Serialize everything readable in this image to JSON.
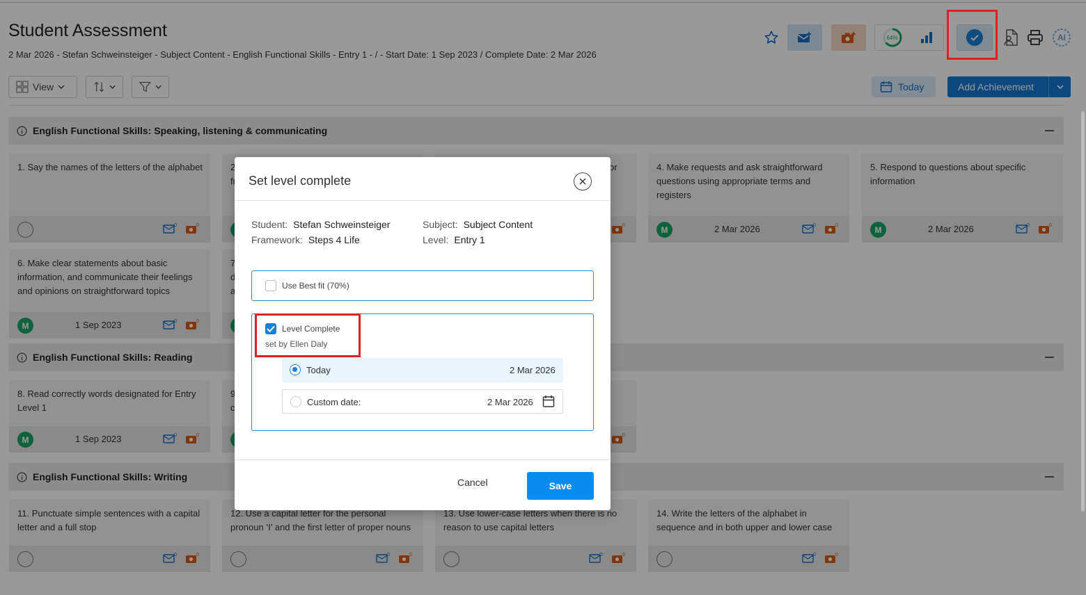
{
  "header": {
    "title": "Student Assessment",
    "subtitle": "2 Mar 2026 - Stefan Schweinsteiger - Subject Content - English Functional Skills - Entry 1 - / - Start Date: 1 Sep 2023 / Complete Date: 2 Mar 2026",
    "progress_percent": "64%",
    "ai_label": "AI"
  },
  "toolbar": {
    "view_label": "View",
    "today_label": "Today",
    "add_achievement_label": "Add Achievement"
  },
  "sections": [
    {
      "title": "English Functional Skills: Speaking, listening & communicating"
    },
    {
      "title": "English Functional Skills: Reading"
    },
    {
      "title": "English Functional Skills: Writing"
    }
  ],
  "cards": {
    "c1": {
      "text": "1. Say the names of the letters of the alphabet"
    },
    "c2": {
      "text": "2.",
      "text2": "fr"
    },
    "c3": {
      "text": "or"
    },
    "c4": {
      "text": "4. Make requests and ask straightforward questions using appropriate terms and registers",
      "badge": "M",
      "date": "2 Mar 2026"
    },
    "c5": {
      "text": "5. Respond to questions about specific information",
      "badge": "M",
      "date": "2 Mar 2026"
    },
    "c6": {
      "text": "6. Make clear statements about basic information, and communicate their feelings and opinions on straightforward topics",
      "badge": "M",
      "date": "1 Sep 2023"
    },
    "c7": {
      "text": "7.",
      "text2": "d",
      "text3": "a"
    },
    "c8": {
      "text": "8. Read correctly words designated for Entry Level 1",
      "badge": "M",
      "date": "1 Sep 2023"
    },
    "c9": {
      "text": "9",
      "text2": "c"
    },
    "c11": {
      "text": "11. Punctuate simple sentences with a capital letter and a full stop"
    },
    "c12": {
      "text": "12. Use a capital letter for the personal pronoun ‘I’ and the first letter of proper nouns"
    },
    "c13": {
      "text": "13. Use lower-case letters when there is no reason to use capital letters"
    },
    "c14": {
      "text": "14. Write the letters of the alphabet in sequence and in both upper and lower case"
    },
    "badge_counts": "0"
  },
  "modal": {
    "title": "Set level complete",
    "student_label": "Student:",
    "student_value": "Stefan Schweinsteiger",
    "subject_label": "Subject:",
    "subject_value": "Subject Content",
    "framework_label": "Framework:",
    "framework_value": "Steps 4 Life",
    "level_label": "Level:",
    "level_value": "Entry 1",
    "best_fit_label": "Use Best fit (70%)",
    "level_complete_label": "Level Complete",
    "set_by": "set by Ellen Daly",
    "today_option_label": "Today",
    "today_option_date": "2 Mar 2026",
    "custom_option_label": "Custom date:",
    "custom_option_date": "2 Mar 2026",
    "cancel_label": "Cancel",
    "save_label": "Save",
    "best_fit_checked": false,
    "level_complete_checked": true,
    "selected_option": "today"
  },
  "colors": {
    "accent": "#1479d0",
    "highlight_box": "#e01f1f",
    "badge_green": "#1aa565",
    "record_orange": "#e0641a"
  }
}
